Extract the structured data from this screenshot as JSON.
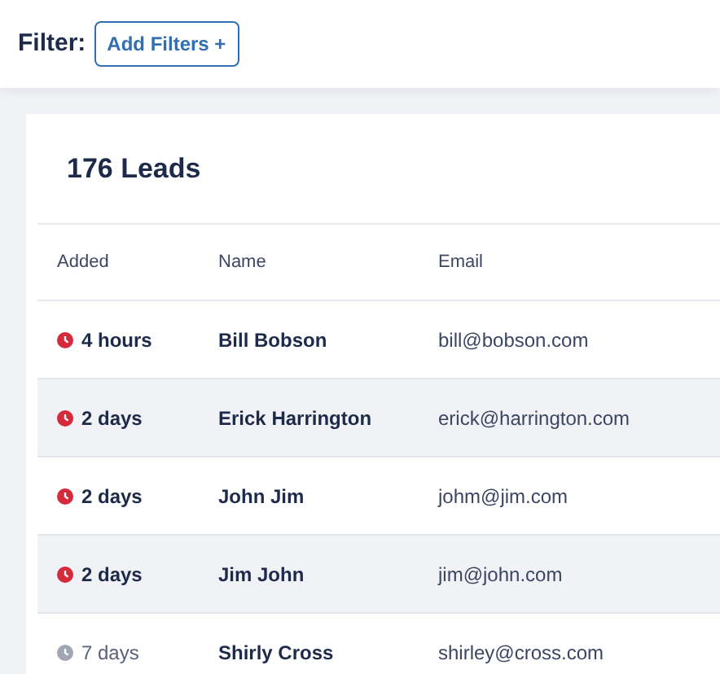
{
  "filter": {
    "label": "Filter:",
    "button": "Add Filters +"
  },
  "leads": {
    "title": "176 Leads",
    "columns": [
      "Added",
      "Name",
      "Email"
    ],
    "rows": [
      {
        "added": "4 hours",
        "recent": true,
        "name": "Bill Bobson",
        "email": "bill@bobson.com"
      },
      {
        "added": "2 days",
        "recent": true,
        "name": "Erick Harrington",
        "email": "erick@harrington.com"
      },
      {
        "added": "2 days",
        "recent": true,
        "name": "John Jim",
        "email": "johm@jim.com"
      },
      {
        "added": "2 days",
        "recent": true,
        "name": "Jim John",
        "email": "jim@john.com"
      },
      {
        "added": "7 days",
        "recent": false,
        "name": "Shirly Cross",
        "email": "shirley@cross.com"
      }
    ]
  }
}
